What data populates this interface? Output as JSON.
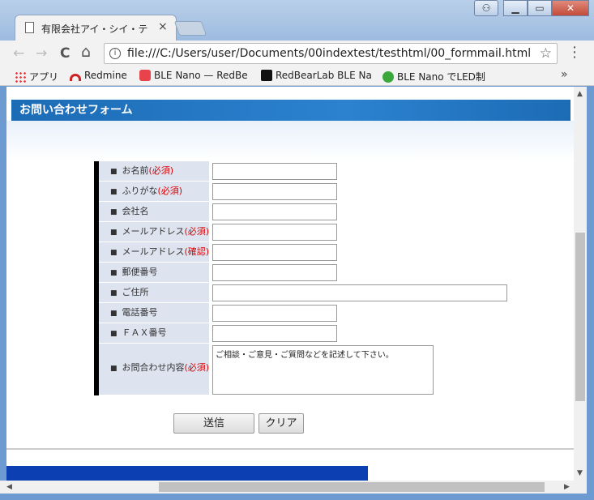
{
  "browser": {
    "tab_title": "有限会社アイ・シイ・テ",
    "tab_close": "×",
    "url": "file:///C:/Users/user/Documents/00indextest/testhtml/00_formmail.html",
    "info_glyph": "i",
    "star_glyph": "☆",
    "menu_glyph": "⋮",
    "back_glyph": "←",
    "forward_glyph": "→",
    "reload_glyph": "C",
    "home_glyph": "⌂",
    "window_buttons": {
      "minimize": "▁",
      "maximize": "▭",
      "close": "✕",
      "user": "⚇"
    },
    "bookmarks": [
      {
        "label": "アプリ",
        "icon": "apps-grid-icon"
      },
      {
        "label": "Redmine",
        "icon": "redmine-icon"
      },
      {
        "label": "BLE Nano — RedBe",
        "icon": "pocket-icon"
      },
      {
        "label": "RedBearLab BLE Na",
        "icon": "redbear-icon"
      },
      {
        "label": "BLE Nano でLED制",
        "icon": "green-icon"
      }
    ],
    "bookmarks_more": "»"
  },
  "page": {
    "header_title": "お問い合わせフォーム",
    "required_mark": "(必須)",
    "confirm_mark": "(確認)",
    "fields": [
      {
        "label": "お名前",
        "suffix": "(必須)",
        "value": ""
      },
      {
        "label": "ふりがな",
        "suffix": "(必須)",
        "value": ""
      },
      {
        "label": "会社名",
        "suffix": "",
        "value": ""
      },
      {
        "label": "メールアドレス",
        "suffix": "(必須)",
        "value": ""
      },
      {
        "label": "メールアドレス",
        "suffix": "(確認)",
        "value": ""
      },
      {
        "label": "郵便番号",
        "suffix": "",
        "value": ""
      },
      {
        "label": "ご住所",
        "suffix": "",
        "value": ""
      },
      {
        "label": "電話番号",
        "suffix": "",
        "value": ""
      },
      {
        "label": "ＦＡＸ番号",
        "suffix": "",
        "value": ""
      },
      {
        "label": "お問合わせ内容",
        "suffix": "(必須)",
        "value": "ご相談・ご意見・ご質問などを記述して下さい。"
      }
    ],
    "submit_label": "送信",
    "clear_label": "クリア",
    "bullet": "■"
  },
  "colors": {
    "header_blue": "#1c6bb5",
    "label_bg": "#dde3ef",
    "required_red": "#dd0000",
    "footer_blue": "#0b3fb2"
  }
}
